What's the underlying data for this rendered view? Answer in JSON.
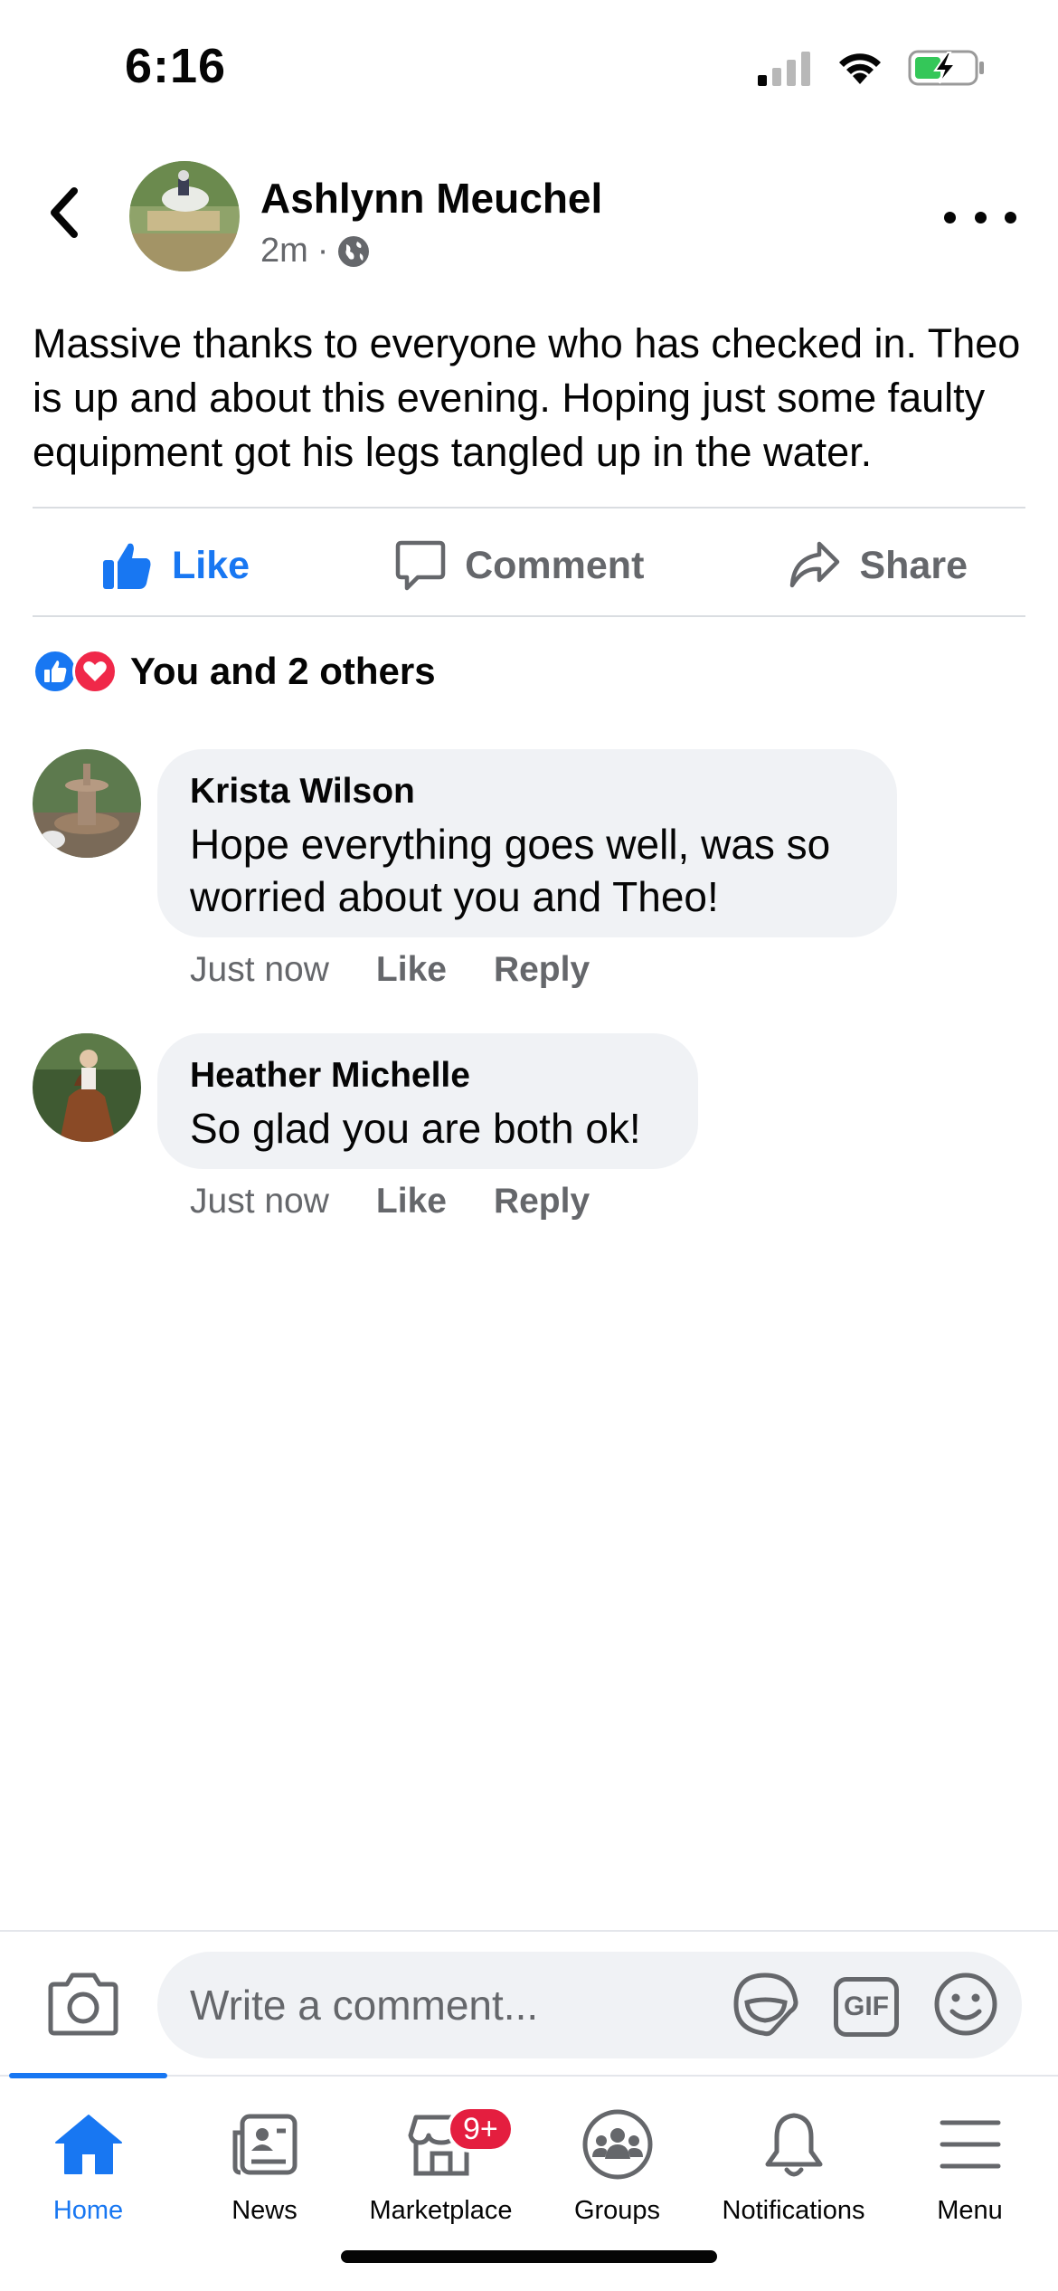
{
  "status_bar": {
    "time": "6:16"
  },
  "post": {
    "author": "Ashlynn Meuchel",
    "time_ago": "2m",
    "separator": "·",
    "privacy_icon": "globe-icon",
    "text": "Massive thanks to everyone who has checked in. Theo is up and about this evening. Hoping just some faulty equipment got his legs tangled up in the water."
  },
  "actions": {
    "like": "Like",
    "comment": "Comment",
    "share": "Share"
  },
  "reactions": {
    "summary": "You and 2 others"
  },
  "comments": [
    {
      "name": "Krista Wilson",
      "text_line1": "Hope everything goes well, was so",
      "text_line2": "worried about you and Theo!",
      "time": "Just now",
      "like": "Like",
      "reply": "Reply"
    },
    {
      "name": "Heather Michelle",
      "text_line1": "So glad you are both ok!",
      "time": "Just now",
      "like": "Like",
      "reply": "Reply"
    }
  ],
  "composer": {
    "placeholder": "Write a comment...",
    "gif_label": "GIF"
  },
  "tabs": [
    {
      "label": "Home",
      "icon": "home-icon"
    },
    {
      "label": "News",
      "icon": "news-icon"
    },
    {
      "label": "Marketplace",
      "icon": "marketplace-icon",
      "badge": "9+"
    },
    {
      "label": "Groups",
      "icon": "groups-icon"
    },
    {
      "label": "Notifications",
      "icon": "bell-icon"
    },
    {
      "label": "Menu",
      "icon": "menu-icon"
    }
  ],
  "colors": {
    "accent": "#1877f2",
    "badge": "#e41e3f",
    "love": "#f02849",
    "muted": "#65676b",
    "bubble": "#f0f2f5"
  }
}
